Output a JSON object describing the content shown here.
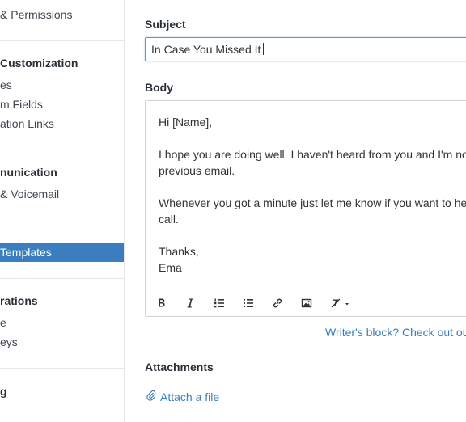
{
  "sidebar": {
    "items": [
      {
        "label": "& Permissions"
      },
      {
        "label": "Customization"
      },
      {
        "label": "es"
      },
      {
        "label": "m Fields"
      },
      {
        "label": "ation Links"
      },
      {
        "label": "nunication"
      },
      {
        "label": "& Voicemail"
      },
      {
        "label": "Templates"
      },
      {
        "label": "rations"
      },
      {
        "label": "e"
      },
      {
        "label": "eys"
      },
      {
        "label": "g"
      }
    ]
  },
  "form": {
    "subject_label": "Subject",
    "subject_value": "In Case You Missed It",
    "body_label": "Body",
    "body_lines": [
      "Hi [Name],",
      "I hope you are doing well. I haven't heard from you and I'm no",
      "previous email.",
      "Whenever you got a minute just let me know if you want to he",
      "call.",
      "Thanks,",
      "Ema"
    ],
    "writers_block_link": "Writer's block? Check out ou",
    "attachments_label": "Attachments",
    "attach_link": "Attach a file"
  },
  "toolbar": {
    "buttons": [
      "bold-icon",
      "italic-icon",
      "ordered-list-icon",
      "bullet-list-icon",
      "link-icon",
      "image-icon",
      "clear-format-icon"
    ]
  },
  "colors": {
    "accent": "#3a7ebf",
    "active_item_bg": "#3a7ebf",
    "border": "#cfd4d9"
  }
}
